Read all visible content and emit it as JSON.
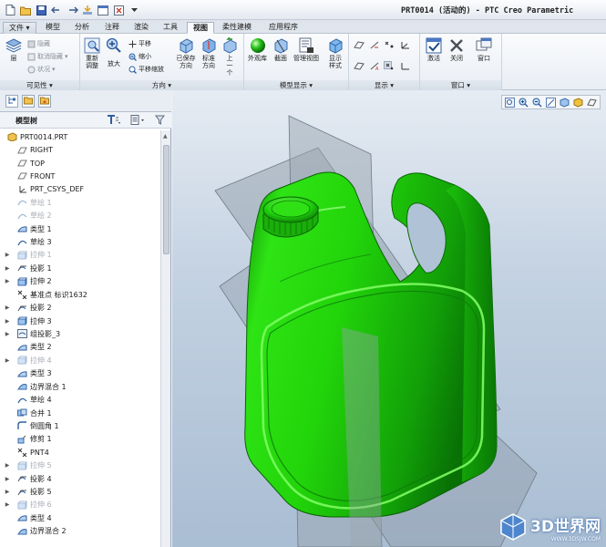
{
  "window": {
    "title": "PRT0014 (活动的) - PTC Creo Parametric"
  },
  "quick_access": [
    "new-icon",
    "open-icon",
    "save-icon",
    "undo-icon",
    "redo-icon",
    "regenerate-icon",
    "windows-icon",
    "close-icon",
    "customize-icon"
  ],
  "tabs": [
    {
      "label": "文件",
      "active": false,
      "kind": "file"
    },
    {
      "label": "模型",
      "active": false
    },
    {
      "label": "分析",
      "active": false
    },
    {
      "label": "注释",
      "active": false
    },
    {
      "label": "渲染",
      "active": false
    },
    {
      "label": "工具",
      "active": false
    },
    {
      "label": "视图",
      "active": true
    },
    {
      "label": "柔性建模",
      "active": false
    },
    {
      "label": "应用程序",
      "active": false
    }
  ],
  "ribbon": {
    "visibility": {
      "layers": "层",
      "hide": "隐藏",
      "unhide": "取消隐藏",
      "status": "状况",
      "footer": "可见性"
    },
    "orientation": {
      "repaint": "重新调整",
      "zoom_in": "放大",
      "pan": "平移",
      "zoom_out": "缩小",
      "pan_zoom": "平移缩放",
      "saved_orientations": "已保存方向",
      "standard_orientation": "标准方向",
      "previous": "上一个",
      "footer": "方向"
    },
    "model_display": {
      "appearance_gallery": "外观库",
      "section": "截面",
      "manage_views": "管理视图",
      "display_style": "显示样式",
      "footer": "模型显示"
    },
    "show": {
      "footer": "显示"
    },
    "window": {
      "activate": "激活",
      "close": "关闭",
      "windows": "窗口",
      "footer": "窗口"
    }
  },
  "model_tree": {
    "title": "模型树",
    "items": [
      {
        "label": "PRT0014.PRT",
        "icon": "part-icon",
        "state": "normal",
        "expander": false,
        "indent": 0
      },
      {
        "label": "RIGHT",
        "icon": "datum-plane-icon",
        "state": "normal",
        "expander": false,
        "indent": 1
      },
      {
        "label": "TOP",
        "icon": "datum-plane-icon",
        "state": "normal",
        "expander": false,
        "indent": 1
      },
      {
        "label": "FRONT",
        "icon": "datum-plane-icon",
        "state": "normal",
        "expander": false,
        "indent": 1
      },
      {
        "label": "PRT_CSYS_DEF",
        "icon": "csys-icon",
        "state": "normal",
        "expander": false,
        "indent": 1
      },
      {
        "label": "草绘 1",
        "icon": "sketch-icon",
        "state": "hidden",
        "expander": false,
        "indent": 1
      },
      {
        "label": "草绘 2",
        "icon": "sketch-icon",
        "state": "hidden",
        "expander": false,
        "indent": 1
      },
      {
        "label": "类型 1",
        "icon": "style-icon",
        "state": "normal",
        "expander": false,
        "indent": 1
      },
      {
        "label": "草绘 3",
        "icon": "sketch-icon",
        "state": "normal",
        "expander": false,
        "indent": 1
      },
      {
        "label": "拉伸 1",
        "icon": "extrude-icon",
        "state": "hidden",
        "expander": true,
        "indent": 1
      },
      {
        "label": "投影 1",
        "icon": "projection-icon",
        "state": "normal",
        "expander": true,
        "indent": 1
      },
      {
        "label": "拉伸 2",
        "icon": "extrude-icon",
        "state": "normal",
        "expander": true,
        "indent": 1
      },
      {
        "label": "基准点 标识1632",
        "icon": "datum-point-icon",
        "state": "normal",
        "expander": false,
        "indent": 1
      },
      {
        "label": "投影 2",
        "icon": "projection-icon",
        "state": "normal",
        "expander": true,
        "indent": 1
      },
      {
        "label": "拉伸 3",
        "icon": "extrude-icon",
        "state": "normal",
        "expander": true,
        "indent": 1
      },
      {
        "label": "组投影_3",
        "icon": "group-icon",
        "state": "normal",
        "expander": true,
        "indent": 1
      },
      {
        "label": "类型 2",
        "icon": "style-icon",
        "state": "normal",
        "expander": false,
        "indent": 1
      },
      {
        "label": "拉伸 4",
        "icon": "extrude-icon",
        "state": "hidden",
        "expander": true,
        "indent": 1
      },
      {
        "label": "类型 3",
        "icon": "style-icon",
        "state": "normal",
        "expander": false,
        "indent": 1
      },
      {
        "label": "边界混合 1",
        "icon": "boundary-blend-icon",
        "state": "normal",
        "expander": false,
        "indent": 1
      },
      {
        "label": "草绘 4",
        "icon": "sketch-icon",
        "state": "normal",
        "expander": false,
        "indent": 1
      },
      {
        "label": "合并 1",
        "icon": "merge-icon",
        "state": "normal",
        "expander": false,
        "indent": 1
      },
      {
        "label": "倒圆角 1",
        "icon": "round-icon",
        "state": "normal",
        "expander": false,
        "indent": 1
      },
      {
        "label": "修剪 1",
        "icon": "trim-icon",
        "state": "normal",
        "expander": false,
        "indent": 1
      },
      {
        "label": "PNT4",
        "icon": "datum-point-icon",
        "state": "normal",
        "expander": false,
        "indent": 1
      },
      {
        "label": "拉伸 5",
        "icon": "extrude-icon",
        "state": "hidden",
        "expander": true,
        "indent": 1
      },
      {
        "label": "投影 4",
        "icon": "projection-icon",
        "state": "normal",
        "expander": true,
        "indent": 1
      },
      {
        "label": "投影 5",
        "icon": "projection-icon",
        "state": "normal",
        "expander": true,
        "indent": 1
      },
      {
        "label": "拉伸 6",
        "icon": "extrude-icon",
        "state": "hidden",
        "expander": true,
        "indent": 1
      },
      {
        "label": "类型 4",
        "icon": "style-icon",
        "state": "normal",
        "expander": false,
        "indent": 1
      },
      {
        "label": "边界混合 2",
        "icon": "boundary-blend-icon",
        "state": "normal",
        "expander": false,
        "indent": 1
      }
    ]
  },
  "view_toolbar": [
    "refit-icon",
    "zoom-in-icon",
    "zoom-out-icon",
    "repaint-icon",
    "saved-views-icon",
    "display-style-icon",
    "datum-display-icon"
  ],
  "watermark": {
    "text": "3D世界网",
    "url": "WWW.3DSJW.COM"
  },
  "colors": {
    "model_green": "#22d40a",
    "viewport_top": "#e6ecf3",
    "viewport_bottom": "#a9bdd3"
  }
}
